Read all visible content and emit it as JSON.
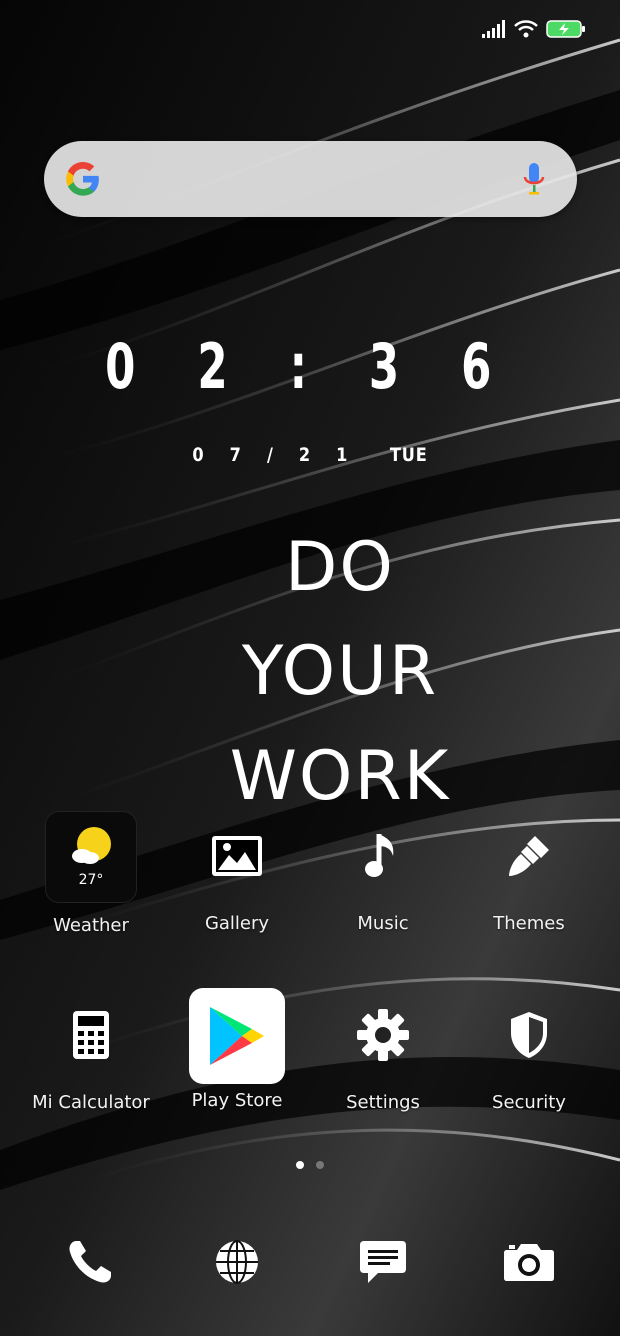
{
  "status": {
    "icons": [
      "signal-icon",
      "wifi-icon",
      "battery-charging-icon"
    ],
    "battery_color": "#4cd964"
  },
  "search": {
    "logo": "google-g-icon",
    "mic": "mic-icon"
  },
  "clock": {
    "time": "0 2 : 3 6",
    "date": "0 7 / 2 1",
    "day": "TUE"
  },
  "quote": {
    "line1": "DO",
    "line2": "YOUR",
    "line3": "WORK"
  },
  "apps_row1": [
    {
      "label": "Weather",
      "icon": "weather-sun-icon",
      "temp": "27°"
    },
    {
      "label": "Gallery",
      "icon": "gallery-icon"
    },
    {
      "label": "Music",
      "icon": "music-note-icon"
    },
    {
      "label": "Themes",
      "icon": "paintbrush-icon"
    }
  ],
  "apps_row2": [
    {
      "label": "Mi Calculator",
      "icon": "calculator-icon"
    },
    {
      "label": "Play Store",
      "icon": "play-store-icon"
    },
    {
      "label": "Settings",
      "icon": "gear-icon"
    },
    {
      "label": "Security",
      "icon": "shield-icon"
    }
  ],
  "pages": {
    "count": 2,
    "active": 1,
    "active_color": "#ffffff",
    "inactive_color": "#777777"
  },
  "dock": [
    {
      "icon": "phone-icon"
    },
    {
      "icon": "browser-globe-icon"
    },
    {
      "icon": "messages-icon"
    },
    {
      "icon": "camera-icon"
    }
  ]
}
